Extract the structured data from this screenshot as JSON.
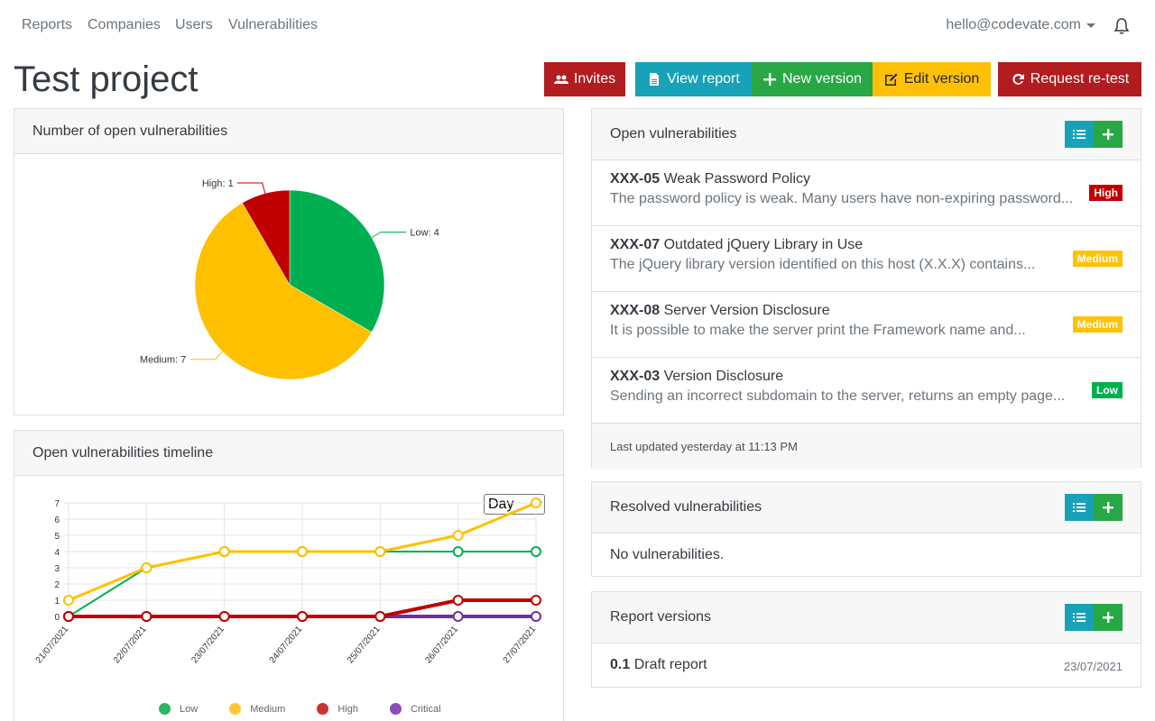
{
  "nav": {
    "links": [
      "Reports",
      "Companies",
      "Users",
      "Vulnerabilities"
    ],
    "user_email": "hello@codevate.com",
    "bell_icon": "bell-icon"
  },
  "page": {
    "title": "Test project"
  },
  "actions": {
    "invites": "Invites",
    "view_report": "View report",
    "new_version": "New version",
    "edit_version": "Edit version",
    "request_retest": "Request re-test"
  },
  "pie_card": {
    "title": "Number of open vulnerabilities"
  },
  "timeline_card": {
    "title": "Open vulnerabilities timeline",
    "period_select": "Day"
  },
  "open_card": {
    "title": "Open vulnerabilities",
    "items": [
      {
        "id": "XXX-05",
        "title": "Weak Password Policy",
        "desc": "The password policy is weak. Many users have non-expiring password...",
        "severity": "High"
      },
      {
        "id": "XXX-07",
        "title": "Outdated jQuery Library in Use",
        "desc": "The jQuery library version identified on this host (X.X.X) contains...",
        "severity": "Medium"
      },
      {
        "id": "XXX-08",
        "title": "Server Version Disclosure",
        "desc": "It is possible to make the server print the Framework name and...",
        "severity": "Medium"
      },
      {
        "id": "XXX-03",
        "title": "Version Disclosure",
        "desc": "Sending an incorrect subdomain to the server, returns an empty page...",
        "severity": "Low"
      }
    ],
    "footer": "Last updated yesterday at 11:13 PM"
  },
  "resolved_card": {
    "title": "Resolved vulnerabilities",
    "empty": "No vulnerabilities."
  },
  "versions_card": {
    "title": "Report versions",
    "items": [
      {
        "version": "0.1",
        "name": "Draft report",
        "date": "23/07/2021"
      }
    ]
  },
  "colors": {
    "low": "#00b050",
    "medium": "#ffc000",
    "high": "#c00000",
    "critical": "#7030a0"
  },
  "chart_data": [
    {
      "type": "pie",
      "title": "Number of open vulnerabilities",
      "categories": [
        "Low",
        "Medium",
        "High"
      ],
      "values": [
        4,
        7,
        1
      ],
      "labels": [
        "Low: 4",
        "Medium: 7",
        "High: 1"
      ]
    },
    {
      "type": "line",
      "title": "Open vulnerabilities timeline",
      "x": [
        "21/07/2021",
        "22/07/2021",
        "23/07/2021",
        "24/07/2021",
        "25/07/2021",
        "26/07/2021",
        "27/07/2021"
      ],
      "yticks": [
        0,
        1,
        2,
        3,
        4,
        5,
        6,
        7
      ],
      "ylim": [
        0,
        7
      ],
      "grid": true,
      "legend": "bottom",
      "series": [
        {
          "name": "Low",
          "values": [
            0,
            3,
            4,
            4,
            4,
            4,
            4
          ]
        },
        {
          "name": "Medium",
          "values": [
            1,
            3,
            4,
            4,
            4,
            5,
            7
          ]
        },
        {
          "name": "High",
          "values": [
            0,
            0,
            0,
            0,
            0,
            1,
            1
          ]
        },
        {
          "name": "Critical",
          "values": [
            0,
            0,
            0,
            0,
            0,
            0,
            0
          ]
        }
      ]
    }
  ]
}
